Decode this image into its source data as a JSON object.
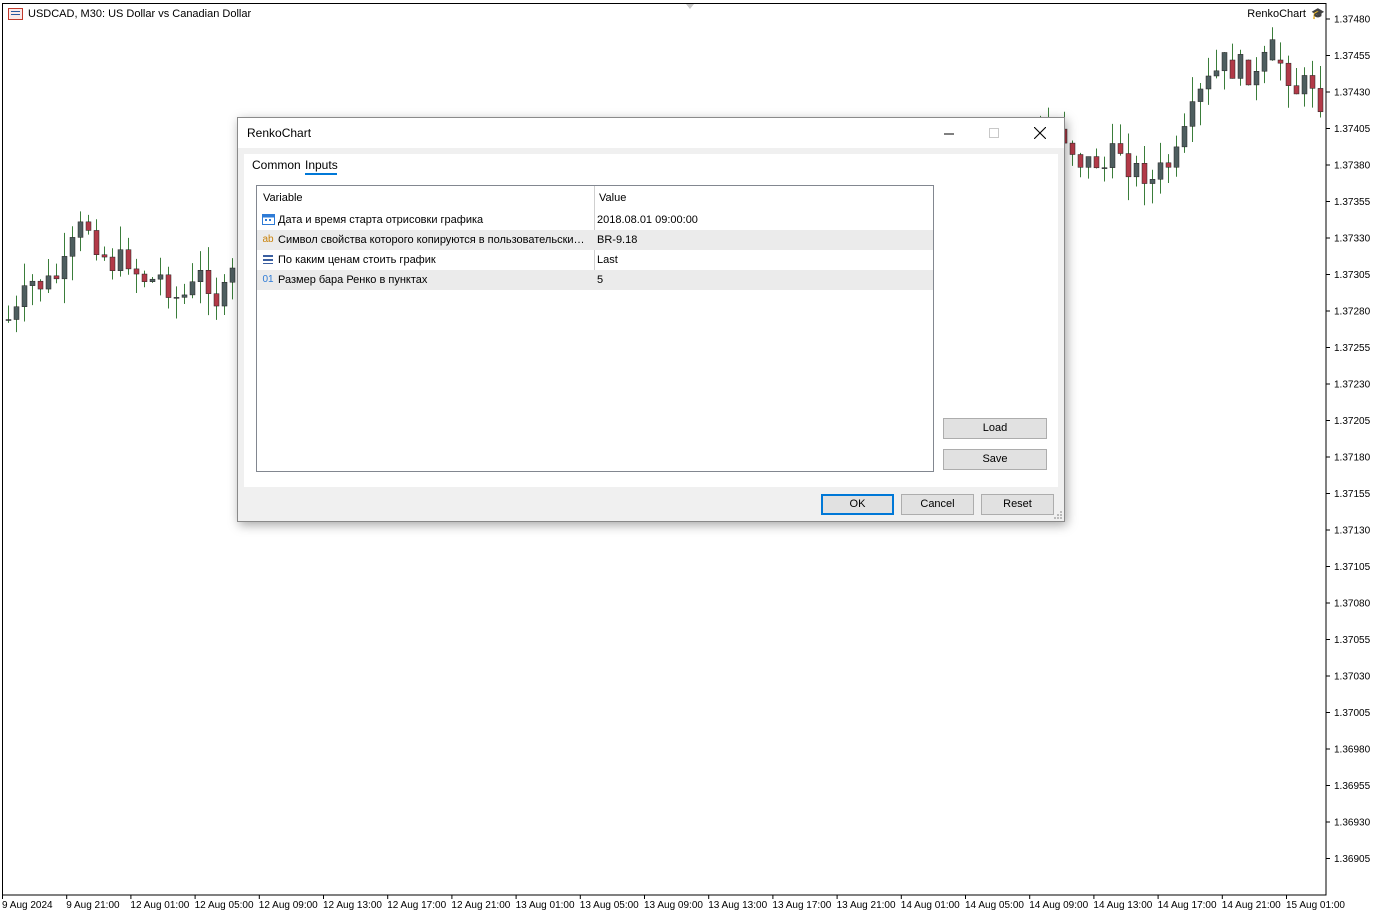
{
  "chart": {
    "symbol_label": "USDCAD, M30:  US Dollar vs Canadian Dollar",
    "indicator_label": "RenkoChart",
    "price_ticks": [
      "1.37480",
      "1.37455",
      "1.37430",
      "1.37405",
      "1.37380",
      "1.37355",
      "1.37330",
      "1.37305",
      "1.37280",
      "1.37255",
      "1.37230",
      "1.37205",
      "1.37180",
      "1.37155",
      "1.37130",
      "1.37105",
      "1.37080",
      "1.37055",
      "1.37030",
      "1.37005",
      "1.36980",
      "1.36955",
      "1.36930",
      "1.36905"
    ],
    "time_ticks": [
      "9 Aug 2024",
      "9 Aug 21:00",
      "12 Aug 01:00",
      "12 Aug 05:00",
      "12 Aug 09:00",
      "12 Aug 13:00",
      "12 Aug 17:00",
      "12 Aug 21:00",
      "13 Aug 01:00",
      "13 Aug 05:00",
      "13 Aug 09:00",
      "13 Aug 13:00",
      "13 Aug 17:00",
      "13 Aug 21:00",
      "14 Aug 01:00",
      "14 Aug 05:00",
      "14 Aug 09:00",
      "14 Aug 13:00",
      "14 Aug 17:00",
      "14 Aug 21:00",
      "15 Aug 01:00"
    ],
    "colors": {
      "bull": "#4e5e5f",
      "bear": "#b23a48",
      "wick": "#3a7d3a",
      "axis": "#000000"
    }
  },
  "dialog": {
    "title": "RenkoChart",
    "tabs": [
      {
        "label": "Common",
        "active": false
      },
      {
        "label": "Inputs",
        "active": true
      }
    ],
    "columns": {
      "variable": "Variable",
      "value": "Value"
    },
    "rows": [
      {
        "icon": "calendar-icon",
        "variable": "Дата и время старта отрисовки графика",
        "value": "2018.08.01 09:00:00"
      },
      {
        "icon": "string-icon",
        "icon_text": "ab",
        "variable": "Символ свойства которого копируются в пользовательский символ",
        "value": "BR-9.18"
      },
      {
        "icon": "enum-icon",
        "variable": "По каким ценам стоить график",
        "value": "Last"
      },
      {
        "icon": "integer-icon",
        "icon_text": "01",
        "variable": "Размер бара Ренко в пунктах",
        "value": "5"
      }
    ],
    "buttons": {
      "load": "Load",
      "save": "Save",
      "ok": "OK",
      "cancel": "Cancel",
      "reset": "Reset"
    }
  }
}
